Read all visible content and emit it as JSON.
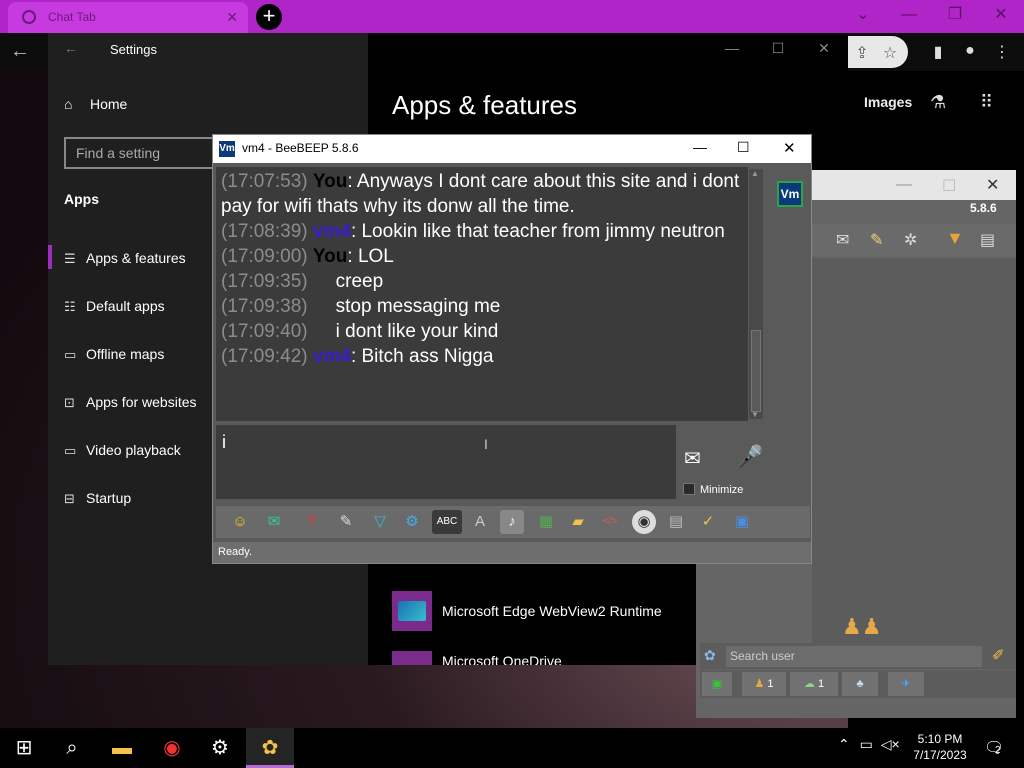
{
  "chrome": {
    "tab_title": "Chat Tab",
    "new_tab": "+",
    "images_link": "Images"
  },
  "settings": {
    "window_title": "Settings",
    "home": "Home",
    "search_placeholder": "Find a setting",
    "section": "Apps",
    "nav": [
      {
        "label": "Apps & features",
        "icon": "list-icon"
      },
      {
        "label": "Default apps",
        "icon": "default-apps-icon"
      },
      {
        "label": "Offline maps",
        "icon": "map-icon"
      },
      {
        "label": "Apps for websites",
        "icon": "web-apps-icon"
      },
      {
        "label": "Video playback",
        "icon": "video-icon"
      },
      {
        "label": "Startup",
        "icon": "startup-icon"
      }
    ],
    "page_title": "Apps & features",
    "apps": [
      {
        "name": "Microsoft Edge WebView2 Runtime"
      },
      {
        "name": "Microsoft OneDrive"
      }
    ]
  },
  "chat": {
    "window_title": "vm4 - BeeBEEP 5.8.6",
    "app_icon_text": "Vm",
    "messages": [
      {
        "time": "(17:07:53)",
        "sender": "You",
        "text": ": Anyways I dont care about this site and i dont pay for wifi thats why its donw all the time."
      },
      {
        "time": "(17:08:39)",
        "sender": "vm4",
        "text": ": Lookin like that teacher from jimmy neutron"
      },
      {
        "time": "(17:09:00)",
        "sender": "You",
        "text": ": LOL"
      },
      {
        "time": "(17:09:35)",
        "sender": "",
        "text": "creep"
      },
      {
        "time": "(17:09:38)",
        "sender": "",
        "text": "stop messaging me"
      },
      {
        "time": "(17:09:40)",
        "sender": "",
        "text": "i dont like your kind"
      },
      {
        "time": "(17:09:42)",
        "sender": "vm4",
        "text": ": Bitch ass Nigga"
      }
    ],
    "input_value": "i",
    "minimize_label": "Minimize",
    "status": "Ready."
  },
  "bee_side": {
    "version": "5.8.6",
    "search_placeholder": "Search user",
    "tabs": [
      {
        "count": "1"
      },
      {
        "count": "1"
      }
    ]
  },
  "taskbar": {
    "time": "5:10 PM",
    "date": "7/17/2023",
    "notification_count": "2"
  }
}
